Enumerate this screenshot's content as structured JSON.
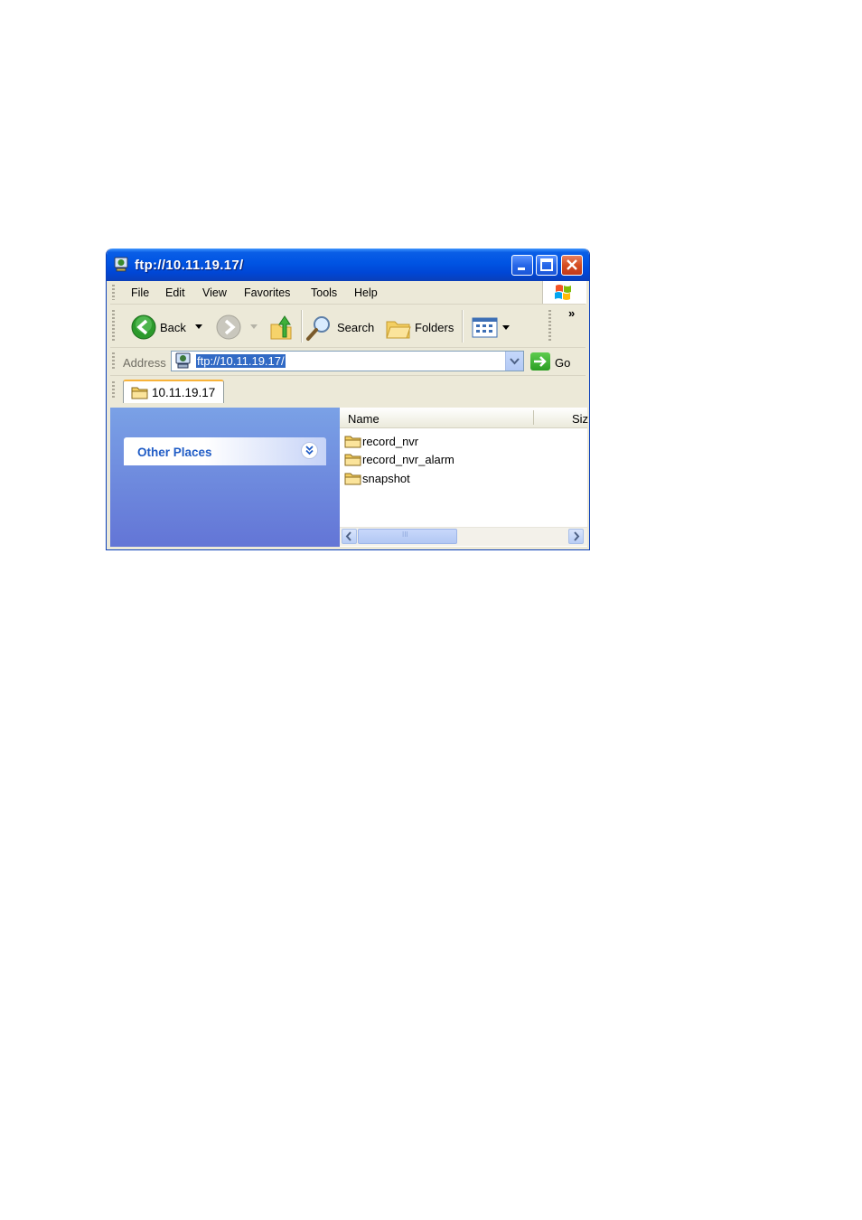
{
  "window": {
    "title": "ftp://10.11.19.17/"
  },
  "menu": {
    "items": [
      "File",
      "Edit",
      "View",
      "Favorites",
      "Tools",
      "Help"
    ]
  },
  "toolbar": {
    "back_label": "Back",
    "search_label": "Search",
    "folders_label": "Folders",
    "more_label": "»"
  },
  "address": {
    "label": "Address",
    "value": "ftp://10.11.19.17/",
    "go_label": "Go"
  },
  "tab": {
    "label": "10.11.19.17"
  },
  "taskpane": {
    "panel_title": "Other Places"
  },
  "filelist": {
    "columns": [
      "Name",
      "Siz"
    ],
    "items": [
      {
        "name": "record_nvr"
      },
      {
        "name": "record_nvr_alarm"
      },
      {
        "name": "snapshot"
      }
    ],
    "scroll_grip": "III"
  },
  "colors": {
    "titlebar": "#0054e3",
    "taskpane": "#6f8ce0",
    "panel_title": "#215dc6",
    "selection": "#316ac5"
  }
}
